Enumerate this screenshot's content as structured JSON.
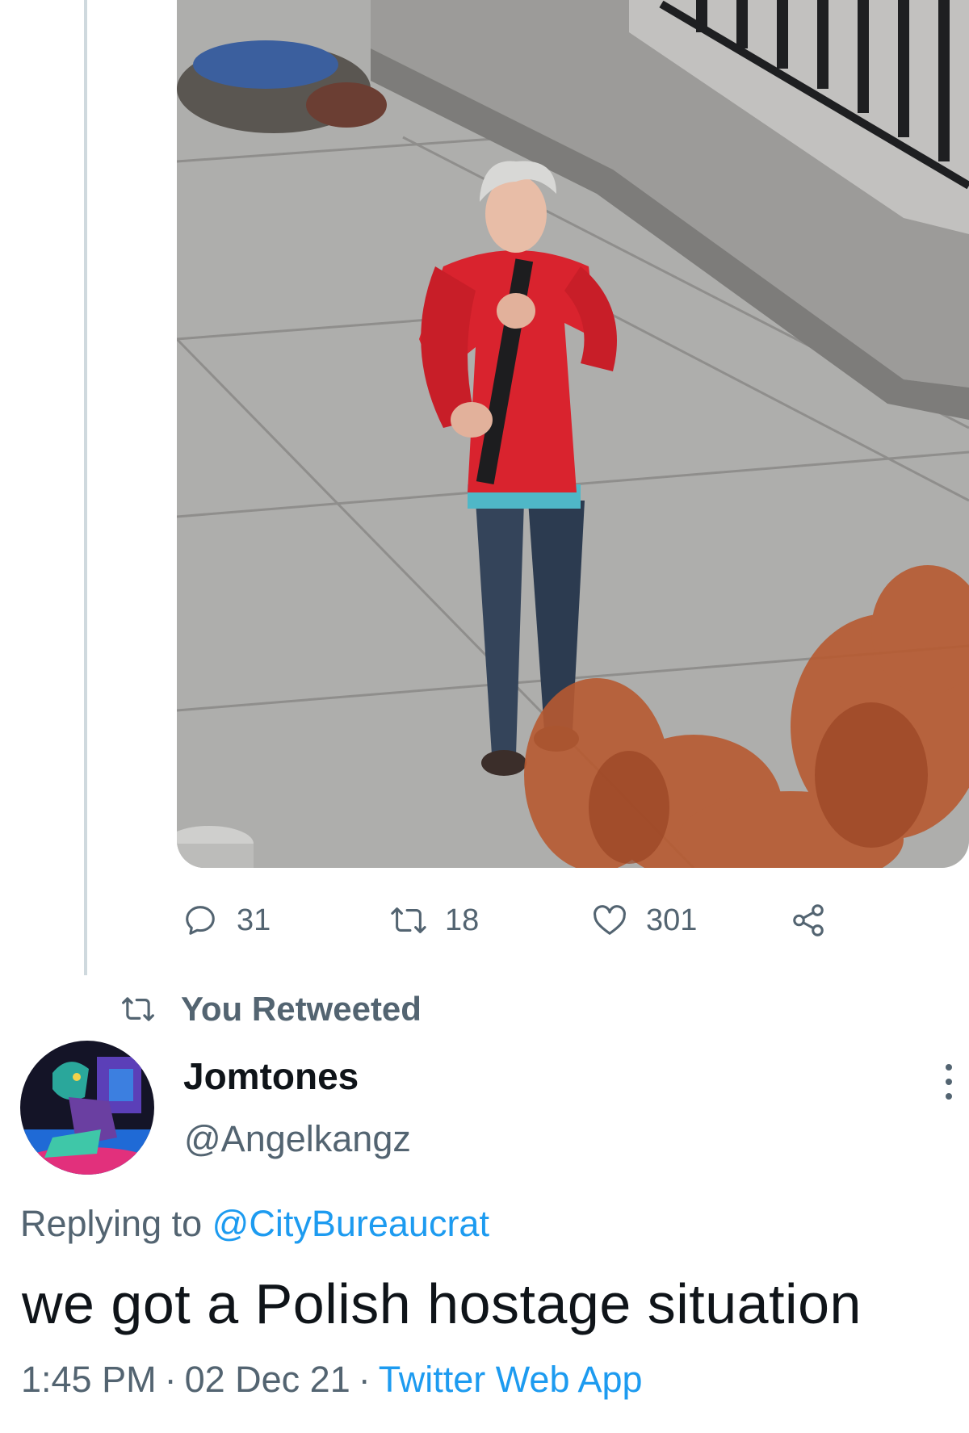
{
  "tweet_actions": {
    "replies": "31",
    "retweets": "18",
    "likes": "301",
    "icons": [
      "reply-icon",
      "retweet-icon",
      "like-icon",
      "share-icon"
    ]
  },
  "retweet_context": {
    "label": "You Retweeted",
    "icon": "retweet-icon"
  },
  "tweet": {
    "display_name": "Jomtones",
    "handle": "@Angelkangz",
    "replying_prefix": "Replying to",
    "replying_to": "@CityBureaucrat",
    "text": "we got a Polish hostage situation",
    "time": "1:45 PM",
    "separator": "·",
    "date": "02 Dec 21",
    "source": "Twitter Web App"
  },
  "colors": {
    "accent": "#1d9bf0",
    "secondary_text": "#536471",
    "primary_text": "#0f1419",
    "thread_line": "#cfd9de"
  }
}
